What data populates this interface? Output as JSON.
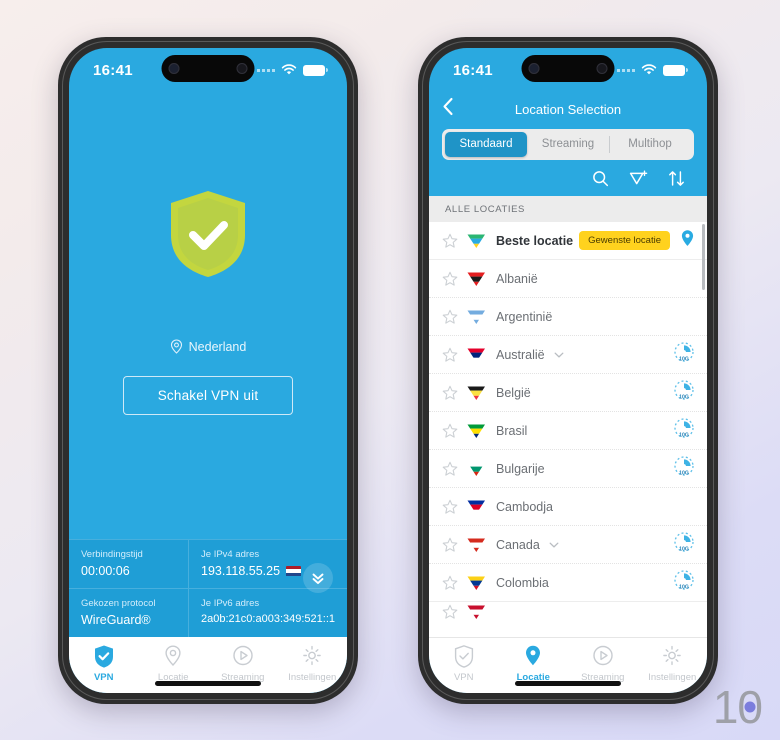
{
  "background": {
    "top_color": "#f7eeec",
    "bottom_color": "#d8d9f7"
  },
  "watermark": {
    "text_one": "1",
    "text_zero": "0"
  },
  "brand": {
    "accent": "#2aa9e0",
    "accent_dark": "#1f9ed6",
    "badge_yellow": "#ffd21e",
    "shield_green": "#b4d335"
  },
  "phone_left": {
    "status_bar": {
      "time": "16:41",
      "wifi_icon": "wifi-icon",
      "battery_icon": "battery-icon",
      "signal_icon": "signal-dots-icon"
    },
    "shield": {
      "icon": "shield-check-icon",
      "state": "connected"
    },
    "location": {
      "icon": "location-pin-icon",
      "label": "Nederland"
    },
    "toggle_button": {
      "label": "Schakel VPN uit"
    },
    "expand_button": {
      "icon": "double-chevron-down-icon"
    },
    "info": [
      {
        "key": "Verbindingstijd",
        "value": "00:00:06",
        "flag": null
      },
      {
        "key": "Je IPv4 adres",
        "value": "193.118.55.25",
        "flag": "nl-flag-icon"
      },
      {
        "key": "Gekozen protocol",
        "value": "WireGuard®",
        "flag": null
      },
      {
        "key": "Je IPv6 adres",
        "value": "2a0b:21c0:a003:349:521::1",
        "flag": null
      }
    ],
    "tabbar": [
      {
        "label": "VPN",
        "icon": "shield-check-icon",
        "active": true
      },
      {
        "label": "Locatie",
        "icon": "location-pin-icon",
        "active": false
      },
      {
        "label": "Streaming",
        "icon": "play-circle-icon",
        "active": false
      },
      {
        "label": "Instellingen",
        "icon": "gear-icon",
        "active": false
      }
    ]
  },
  "phone_right": {
    "status_bar": {
      "time": "16:41",
      "wifi_icon": "wifi-icon",
      "battery_icon": "battery-icon",
      "signal_icon": "signal-dots-icon"
    },
    "header": {
      "back_icon": "chevron-left-icon",
      "title": "Location Selection"
    },
    "segments": [
      {
        "label": "Standaard",
        "active": true
      },
      {
        "label": "Streaming",
        "active": false
      },
      {
        "label": "Multihop",
        "active": false
      }
    ],
    "tools": [
      {
        "icon": "search-icon",
        "name": "search-button"
      },
      {
        "icon": "flag-plus-icon",
        "name": "add-flag-button"
      },
      {
        "icon": "sort-arrows-icon",
        "name": "sort-button"
      }
    ],
    "list_header": "ALLE LOCATIES",
    "rows": [
      {
        "label": "Beste locatie",
        "best": true,
        "badge": "Gewenste locatie",
        "pin": true,
        "expandable": false,
        "speed": false,
        "flag": "best-location-flag-icon",
        "flag_colors": [
          "#2bb673",
          "#29abe2",
          "#ffd21e"
        ]
      },
      {
        "label": "Albanië",
        "best": false,
        "badge": null,
        "pin": false,
        "expandable": false,
        "speed": false,
        "flag": "albania-flag-icon",
        "flag_colors": [
          "#e41e20",
          "#1a1a1a",
          "#e41e20"
        ]
      },
      {
        "label": "Argentinië",
        "best": false,
        "badge": null,
        "pin": false,
        "expandable": false,
        "speed": false,
        "flag": "argentina-flag-icon",
        "flag_colors": [
          "#74acdf",
          "#ffffff",
          "#74acdf"
        ]
      },
      {
        "label": "Australië",
        "best": false,
        "badge": null,
        "pin": false,
        "expandable": true,
        "speed": true,
        "flag": "australia-flag-icon",
        "flag_colors": [
          "#e4002b",
          "#00247d",
          "#ffffff"
        ]
      },
      {
        "label": "België",
        "best": false,
        "badge": null,
        "pin": false,
        "expandable": false,
        "speed": true,
        "flag": "belgium-flag-icon",
        "flag_colors": [
          "#1a1a1a",
          "#fae042",
          "#ef3340"
        ]
      },
      {
        "label": "Brasil",
        "best": false,
        "badge": null,
        "pin": false,
        "expandable": false,
        "speed": true,
        "flag": "brazil-flag-icon",
        "flag_colors": [
          "#009b3a",
          "#fedf00",
          "#002776"
        ]
      },
      {
        "label": "Bulgarije",
        "best": false,
        "badge": null,
        "pin": false,
        "expandable": false,
        "speed": true,
        "flag": "bulgaria-flag-icon",
        "flag_colors": [
          "#ffffff",
          "#00966e",
          "#d62612"
        ]
      },
      {
        "label": "Cambodja",
        "best": false,
        "badge": null,
        "pin": false,
        "expandable": false,
        "speed": false,
        "flag": "cambodia-flag-icon",
        "flag_colors": [
          "#032ea1",
          "#e00025",
          "#ffffff"
        ]
      },
      {
        "label": "Canada",
        "best": false,
        "badge": null,
        "pin": false,
        "expandable": true,
        "speed": true,
        "flag": "canada-flag-icon",
        "flag_colors": [
          "#d52b1e",
          "#ffffff",
          "#d52b1e"
        ]
      },
      {
        "label": "Colombia",
        "best": false,
        "badge": null,
        "pin": false,
        "expandable": false,
        "speed": true,
        "flag": "colombia-flag-icon",
        "flag_colors": [
          "#fcd116",
          "#003893",
          "#ce1126"
        ]
      }
    ],
    "speed_badge_label": "10G",
    "tabbar": [
      {
        "label": "VPN",
        "icon": "shield-check-icon",
        "active": false
      },
      {
        "label": "Locatie",
        "icon": "location-pin-icon",
        "active": true
      },
      {
        "label": "Streaming",
        "icon": "play-circle-icon",
        "active": false
      },
      {
        "label": "Instellingen",
        "icon": "gear-icon",
        "active": false
      }
    ]
  }
}
